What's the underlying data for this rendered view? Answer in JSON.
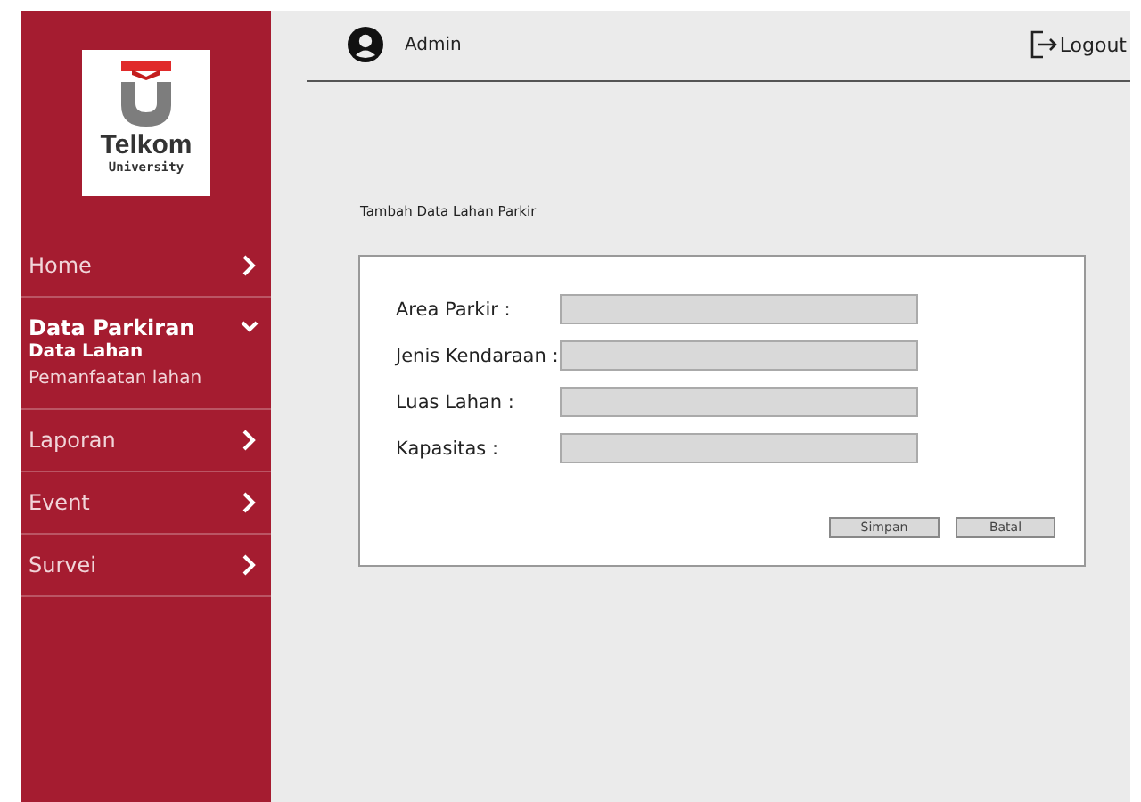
{
  "sidebar": {
    "logo": {
      "name": "Telkom",
      "subtitle": "University"
    },
    "items": [
      {
        "label": "Home",
        "expanded": false
      },
      {
        "label": "Data Parkiran",
        "expanded": true,
        "children": [
          {
            "label": "Data Lahan",
            "selected": true
          },
          {
            "label": "Pemanfaatan lahan",
            "selected": false
          }
        ]
      },
      {
        "label": "Laporan",
        "expanded": false
      },
      {
        "label": "Event",
        "expanded": false
      },
      {
        "label": "Survei",
        "expanded": false
      }
    ]
  },
  "header": {
    "user": "Admin",
    "logout": "Logout"
  },
  "page_title": "Tambah Data Lahan Parkir",
  "form": {
    "fields": [
      {
        "label": "Area Parkir :"
      },
      {
        "label": "Jenis Kendaraan :"
      },
      {
        "label": "Luas Lahan :"
      },
      {
        "label": "Kapasitas :"
      }
    ],
    "buttons": [
      "Simpan",
      "Batal"
    ]
  }
}
